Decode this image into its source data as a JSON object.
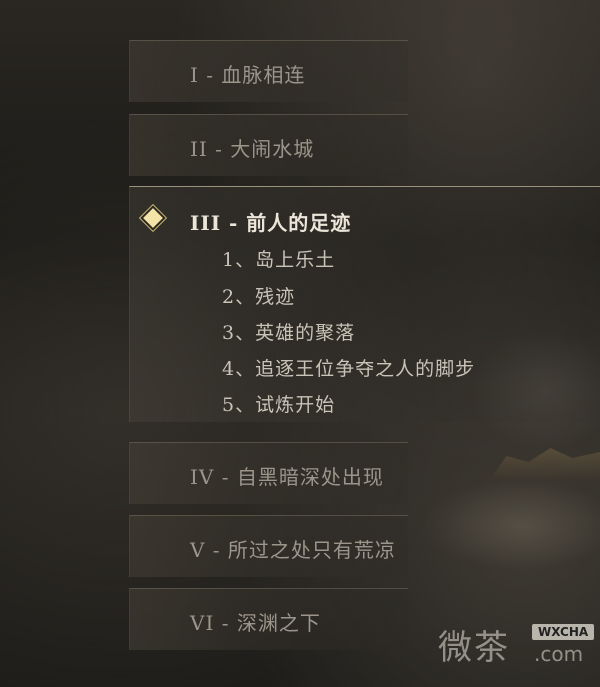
{
  "chapters": [
    {
      "title": "I - 血脉相连"
    },
    {
      "title": "II - 大闹水城"
    },
    {
      "title": "III - 前人的足迹",
      "sections": [
        "1、岛上乐土",
        "2、残迹",
        "3、英雄的聚落",
        "4、追逐王位争夺之人的脚步",
        "5、试炼开始"
      ]
    },
    {
      "title": "IV - 自黑暗深处出现"
    },
    {
      "title": "V - 所过之处只有荒凉"
    },
    {
      "title": "VI - 深渊之下"
    }
  ],
  "watermark": {
    "cn": "微茶",
    "badge": "WXCHA",
    "domain": ".com"
  },
  "colors": {
    "selected_marker": "#f3e3a6",
    "active_text": "#ece6da",
    "inactive_text": "#9b958b"
  }
}
